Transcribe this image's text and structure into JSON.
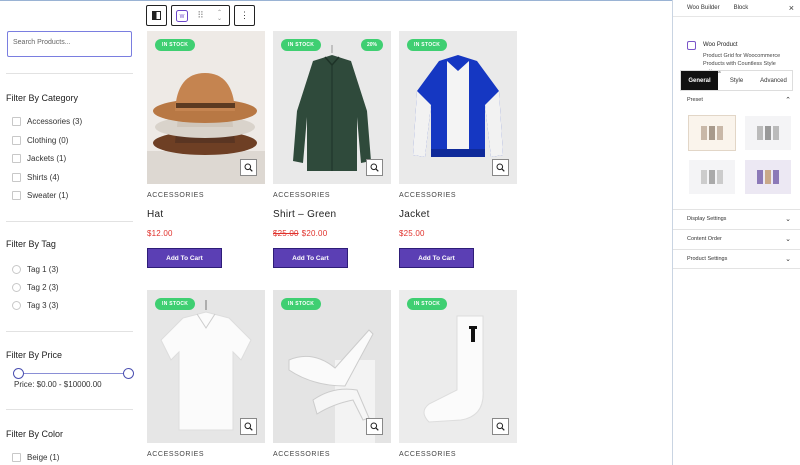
{
  "filters": {
    "search_placeholder": "Search Products...",
    "category": {
      "title": "Filter By Category",
      "items": [
        "Accessories (3)",
        "Clothing (0)",
        "Jackets (1)",
        "Shirts (4)",
        "Sweater (1)"
      ]
    },
    "tag": {
      "title": "Filter By Tag",
      "items": [
        "Tag 1 (3)",
        "Tag 2 (3)",
        "Tag 3 (3)"
      ]
    },
    "price": {
      "title": "Filter By Price",
      "text": "Price:  $0.00 - $10000.00",
      "min_value": 0,
      "max_value": 10000
    },
    "color": {
      "title": "Filter By Color",
      "items": [
        "Beige (1)"
      ]
    }
  },
  "toolbar": {
    "icons": [
      "sidebar-toggle-icon",
      "block-type-icon",
      "drag-handle-icon",
      "move-up-down-icon",
      "more-options-icon"
    ]
  },
  "products": [
    {
      "badge": "IN STOCK",
      "sale": "",
      "category": "ACCESSORIES",
      "name": "Hat",
      "old_price": "",
      "price": "$12.00",
      "button": "Add To Cart",
      "image": "stacked-hats"
    },
    {
      "badge": "IN STOCK",
      "sale": "20%",
      "category": "ACCESSORIES",
      "name": "Shirt – Green",
      "old_price": "$25.00",
      "price": "$20.00",
      "button": "Add To Cart",
      "image": "green-shirt"
    },
    {
      "badge": "IN STOCK",
      "sale": "",
      "category": "ACCESSORIES",
      "name": "Jacket",
      "old_price": "",
      "price": "$25.00",
      "button": "Add To Cart",
      "image": "blue-jacket"
    },
    {
      "badge": "IN STOCK",
      "sale": "",
      "category": "ACCESSORIES",
      "image": "white-polo"
    },
    {
      "badge": "IN STOCK",
      "sale": "",
      "category": "ACCESSORIES",
      "image": "white-heels"
    },
    {
      "badge": "IN STOCK",
      "sale": "",
      "category": "ACCESSORIES",
      "image": "white-sock"
    }
  ],
  "panel": {
    "tabs": [
      "Woo Builder",
      "Block"
    ],
    "close": "×",
    "block_title": "Woo Product",
    "block_desc": "Product Grid for Woocommerce Products with Countless Style options",
    "style_tabs": [
      "General",
      "Style",
      "Advanced"
    ],
    "preset_label": "Preset",
    "sections": [
      "Display Settings",
      "Content Order",
      "Product Settings"
    ]
  },
  "colors": {
    "accent": "#5b3fb4",
    "badge_green": "#3fcf72",
    "sale_red": "#e0312b"
  }
}
